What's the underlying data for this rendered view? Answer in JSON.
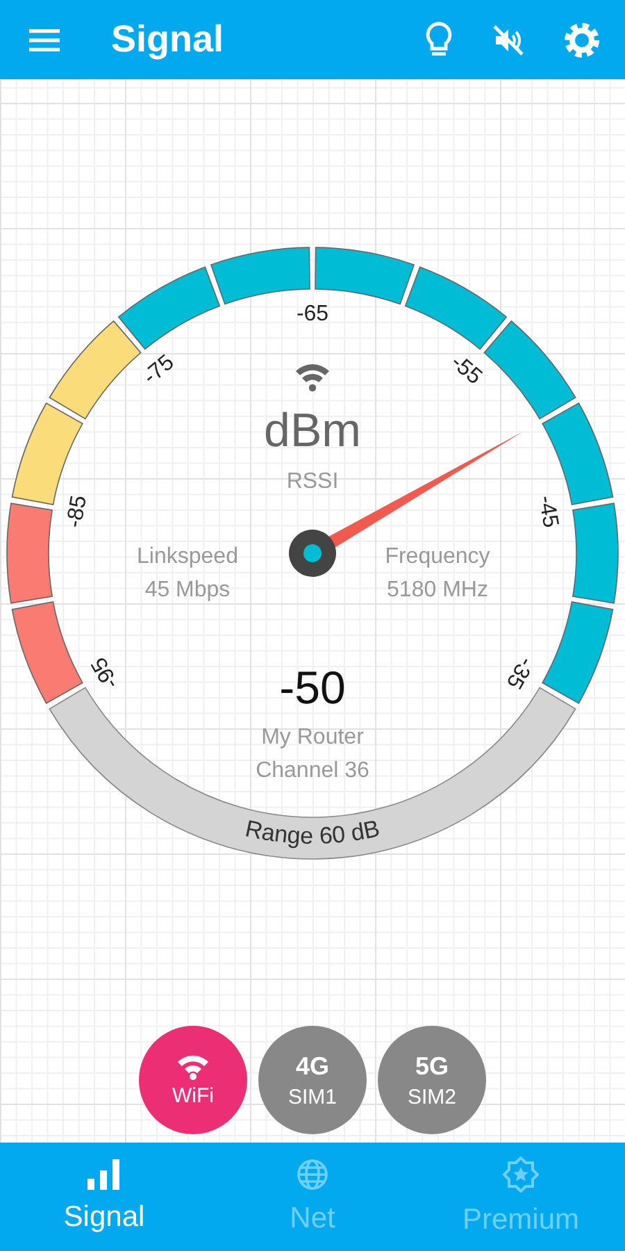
{
  "app_bar": {
    "title": "Signal"
  },
  "gauge": {
    "unit": "dBm",
    "metric": "RSSI",
    "reading": "-50",
    "network": "My Router",
    "channel": "Channel 36",
    "range": "Range 60 dB",
    "left_label": "Linkspeed",
    "left_value": "45 Mbps",
    "right_label": "Frequency",
    "right_value": "5180 MHz",
    "ticks": [
      "-95",
      "-85",
      "-75",
      "-65",
      "-55",
      "-45",
      "-35"
    ],
    "segments": [
      {
        "color": "#fa7b72"
      },
      {
        "color": "#fa7b72"
      },
      {
        "color": "#fbdc7a"
      },
      {
        "color": "#fbdc7a"
      },
      {
        "color": "#00bcd4"
      },
      {
        "color": "#00bcd4"
      },
      {
        "color": "#00bcd4"
      },
      {
        "color": "#00bcd4"
      },
      {
        "color": "#00bcd4"
      },
      {
        "color": "#00bcd4"
      },
      {
        "color": "#00bcd4"
      },
      {
        "color": "#00bcd4"
      }
    ]
  },
  "modes": [
    {
      "kind": "wifi",
      "label": "WiFi",
      "selected": true
    },
    {
      "kind": "sim",
      "title": "4G",
      "label": "SIM1",
      "selected": false
    },
    {
      "kind": "sim",
      "title": "5G",
      "label": "SIM2",
      "selected": false
    }
  ],
  "bottom_nav": [
    {
      "kind": "signal",
      "label": "Signal",
      "selected": true
    },
    {
      "kind": "net",
      "label": "Net",
      "selected": false
    },
    {
      "kind": "premium",
      "label": "Premium",
      "selected": false
    }
  ]
}
